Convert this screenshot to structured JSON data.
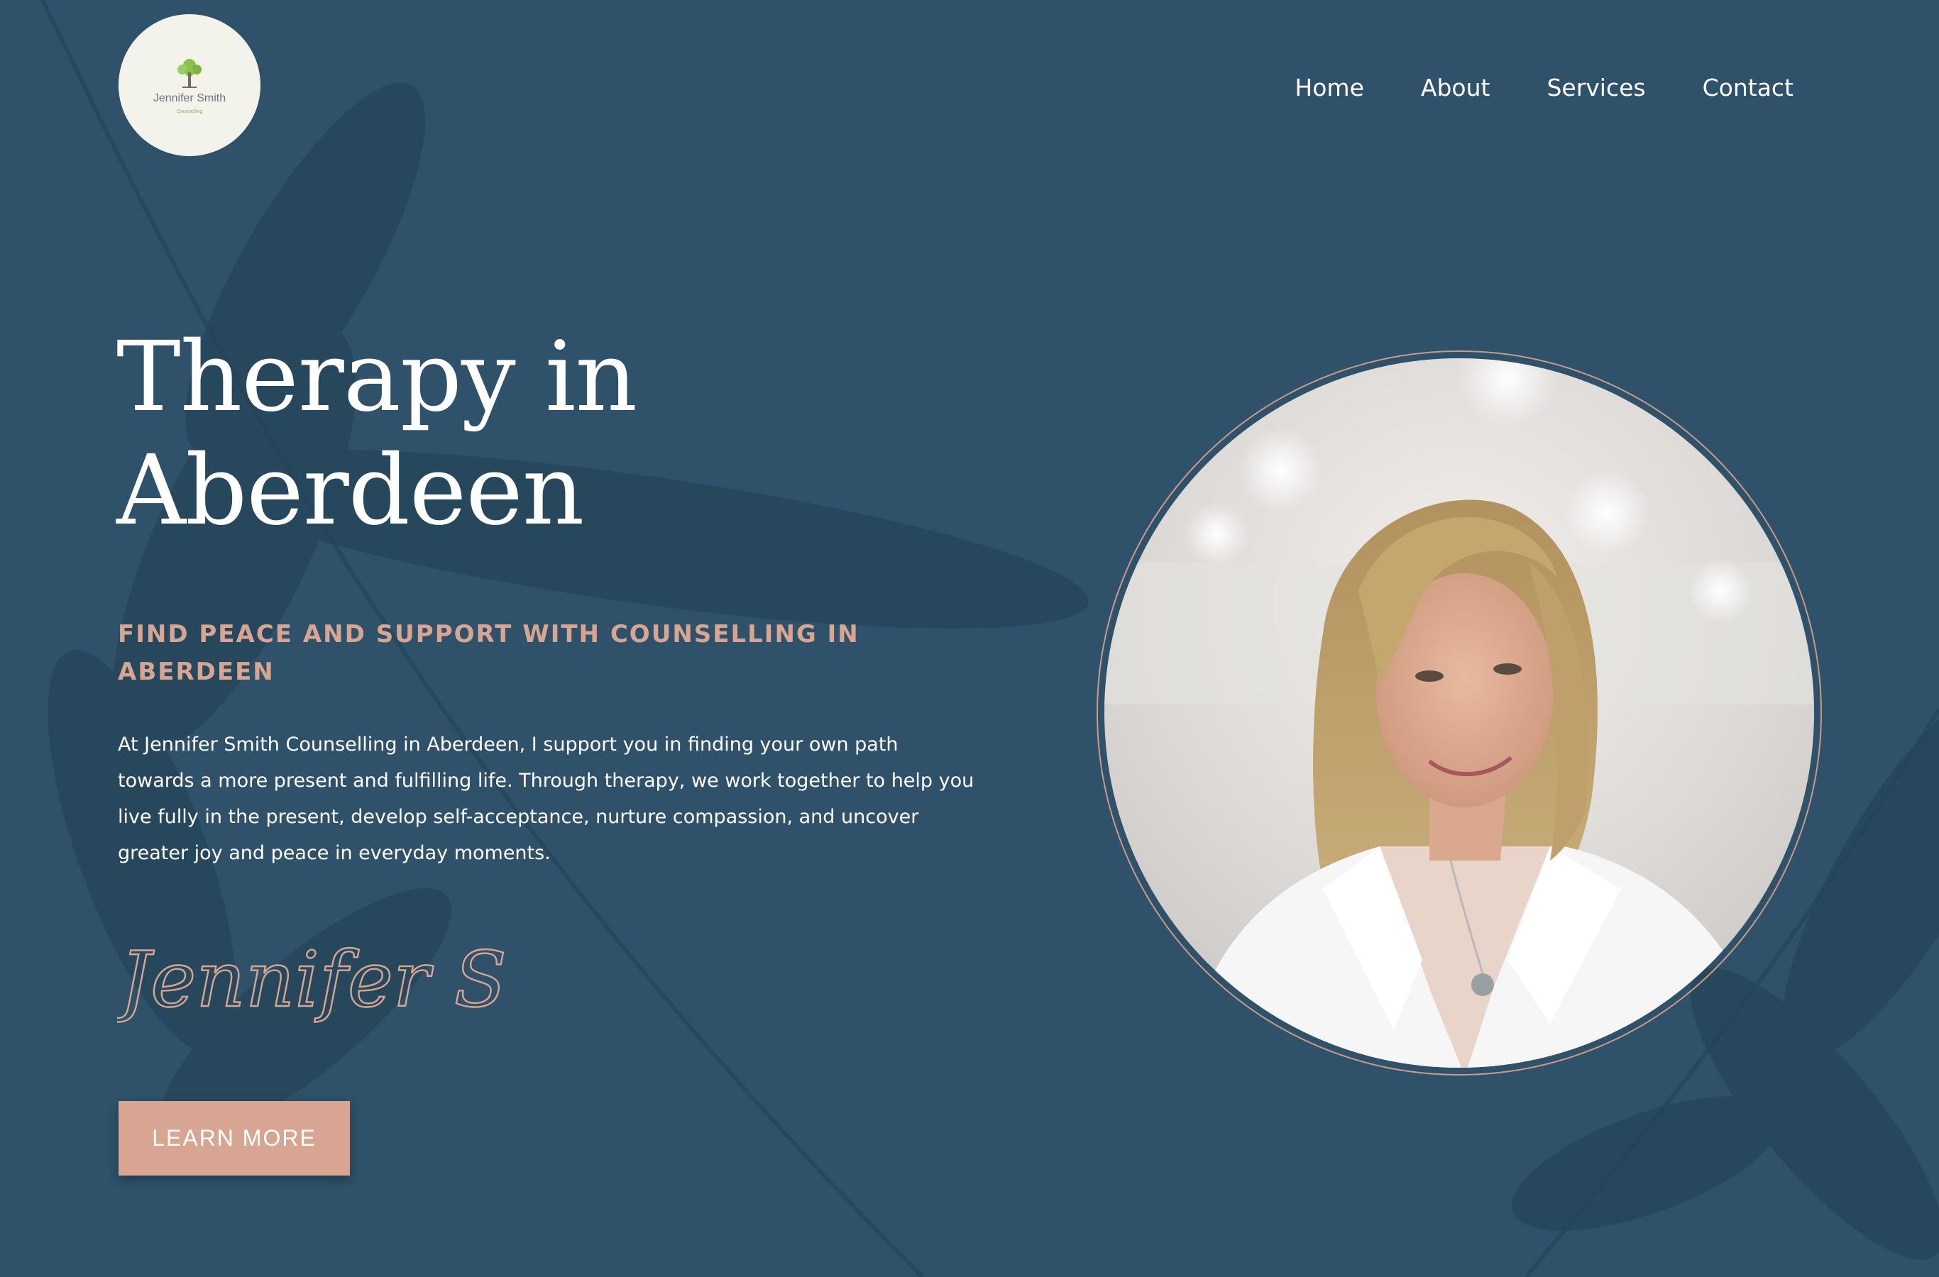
{
  "logo": {
    "name": "Jennifer Smith",
    "subtitle": "Counselling"
  },
  "nav": {
    "items": [
      "Home",
      "About",
      "Services",
      "Contact"
    ]
  },
  "hero": {
    "headline_line1": "Therapy in",
    "headline_line2": "Aberdeen",
    "subtitle": "FIND PEACE AND SUPPORT WITH COUNSELLING IN ABERDEEN",
    "body": "At Jennifer Smith Counselling in Aberdeen, I support you in finding your own path towards a more present and fulfilling life. Through therapy, we work together to help you live fully in the present, develop self-acceptance, nurture compassion, and uncover greater joy and peace in everyday moments.",
    "signature": "Jennifer S .",
    "cta_label": "LEARN MORE"
  },
  "colors": {
    "background": "#2f5169",
    "accent": "#d8a592",
    "text": "#ffffff",
    "logo_bg": "#f3f3ec"
  },
  "icons": {
    "logo_mark": "tree-icon"
  }
}
